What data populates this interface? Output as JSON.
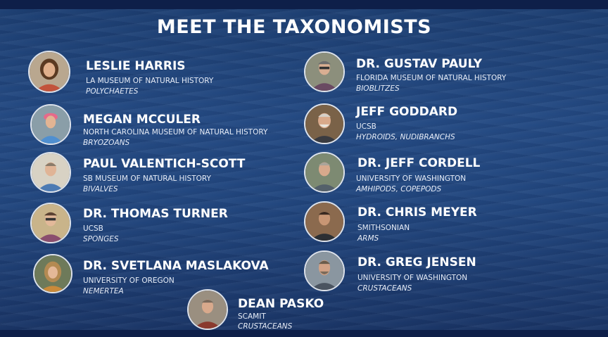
{
  "title": "MEET THE TAXONOMISTS",
  "people": [
    {
      "name": "LESLIE HARRIS",
      "institution": "LA MUSEUM OF NATURAL HISTORY",
      "specialty": "POLYCHAETES"
    },
    {
      "name": "MEGAN MCCULER",
      "institution": "NORTH CAROLINA MUSEUM OF NATURAL HISTORY",
      "specialty": "BRYOZOANS"
    },
    {
      "name": "PAUL VALENTICH-SCOTT",
      "institution": "SB MUSEUM OF NATURAL HISTORY",
      "specialty": "BIVALVES"
    },
    {
      "name": "DR. THOMAS TURNER",
      "institution": "UCSB",
      "specialty": "SPONGES"
    },
    {
      "name": "DR. SVETLANA MASLAKOVA",
      "institution": "UNIVERSITY OF OREGON",
      "specialty": "NEMERTEA"
    },
    {
      "name": "DR. GUSTAV PAULY",
      "institution": "FLORIDA MUSEUM OF NATURAL HISTORY",
      "specialty": "BIOBLITZES"
    },
    {
      "name": "JEFF GODDARD",
      "institution": "UCSB",
      "specialty": "HYDROIDS, NUDIBRANCHS"
    },
    {
      "name": "DR. JEFF CORDELL",
      "institution": "UNIVERSITY OF WASHINGTON",
      "specialty": "AMHIPODS, COPEPODS"
    },
    {
      "name": "DR. CHRIS MEYER",
      "institution": "SMITHSONIAN",
      "specialty": "ARMS"
    },
    {
      "name": "DR. GREG JENSEN",
      "institution": "UNIVERSITY OF WASHINGTON",
      "specialty": "CRUSTACEANS"
    },
    {
      "name": "DEAN PASKO",
      "institution": "SCAMIT",
      "specialty": "CRUSTACEANS"
    }
  ],
  "colors": {
    "background": "#22477f",
    "band": "#0e1f49",
    "text": "#ffffff"
  }
}
